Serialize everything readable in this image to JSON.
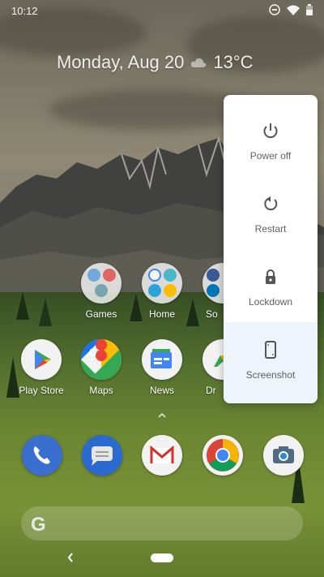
{
  "status_bar": {
    "time": "10:12"
  },
  "glance": {
    "date": "Monday, Aug 20",
    "temperature": "13°C"
  },
  "apps_row1": [
    {
      "label": "Games"
    },
    {
      "label": "Home"
    },
    {
      "label": "So"
    }
  ],
  "apps_row2": [
    {
      "label": "Play Store"
    },
    {
      "label": "Maps"
    },
    {
      "label": "News"
    },
    {
      "label": "Dr"
    }
  ],
  "power_menu": {
    "items": [
      {
        "label": "Power off",
        "icon": "power-icon"
      },
      {
        "label": "Restart",
        "icon": "restart-icon"
      },
      {
        "label": "Lockdown",
        "icon": "lock-icon"
      },
      {
        "label": "Screenshot",
        "icon": "screenshot-icon"
      }
    ]
  },
  "dock": [
    {
      "icon": "phone-icon"
    },
    {
      "icon": "messages-icon"
    },
    {
      "icon": "gmail-icon"
    },
    {
      "icon": "chrome-icon"
    },
    {
      "icon": "camera-icon"
    }
  ],
  "search": {
    "icon": "google-g-icon",
    "letter": "G"
  },
  "colors": {
    "menu_bg": "#ffffff",
    "menu_selected": "#eef4fb",
    "menu_text": "#5f5f5f",
    "text_light": "#ffffff"
  }
}
